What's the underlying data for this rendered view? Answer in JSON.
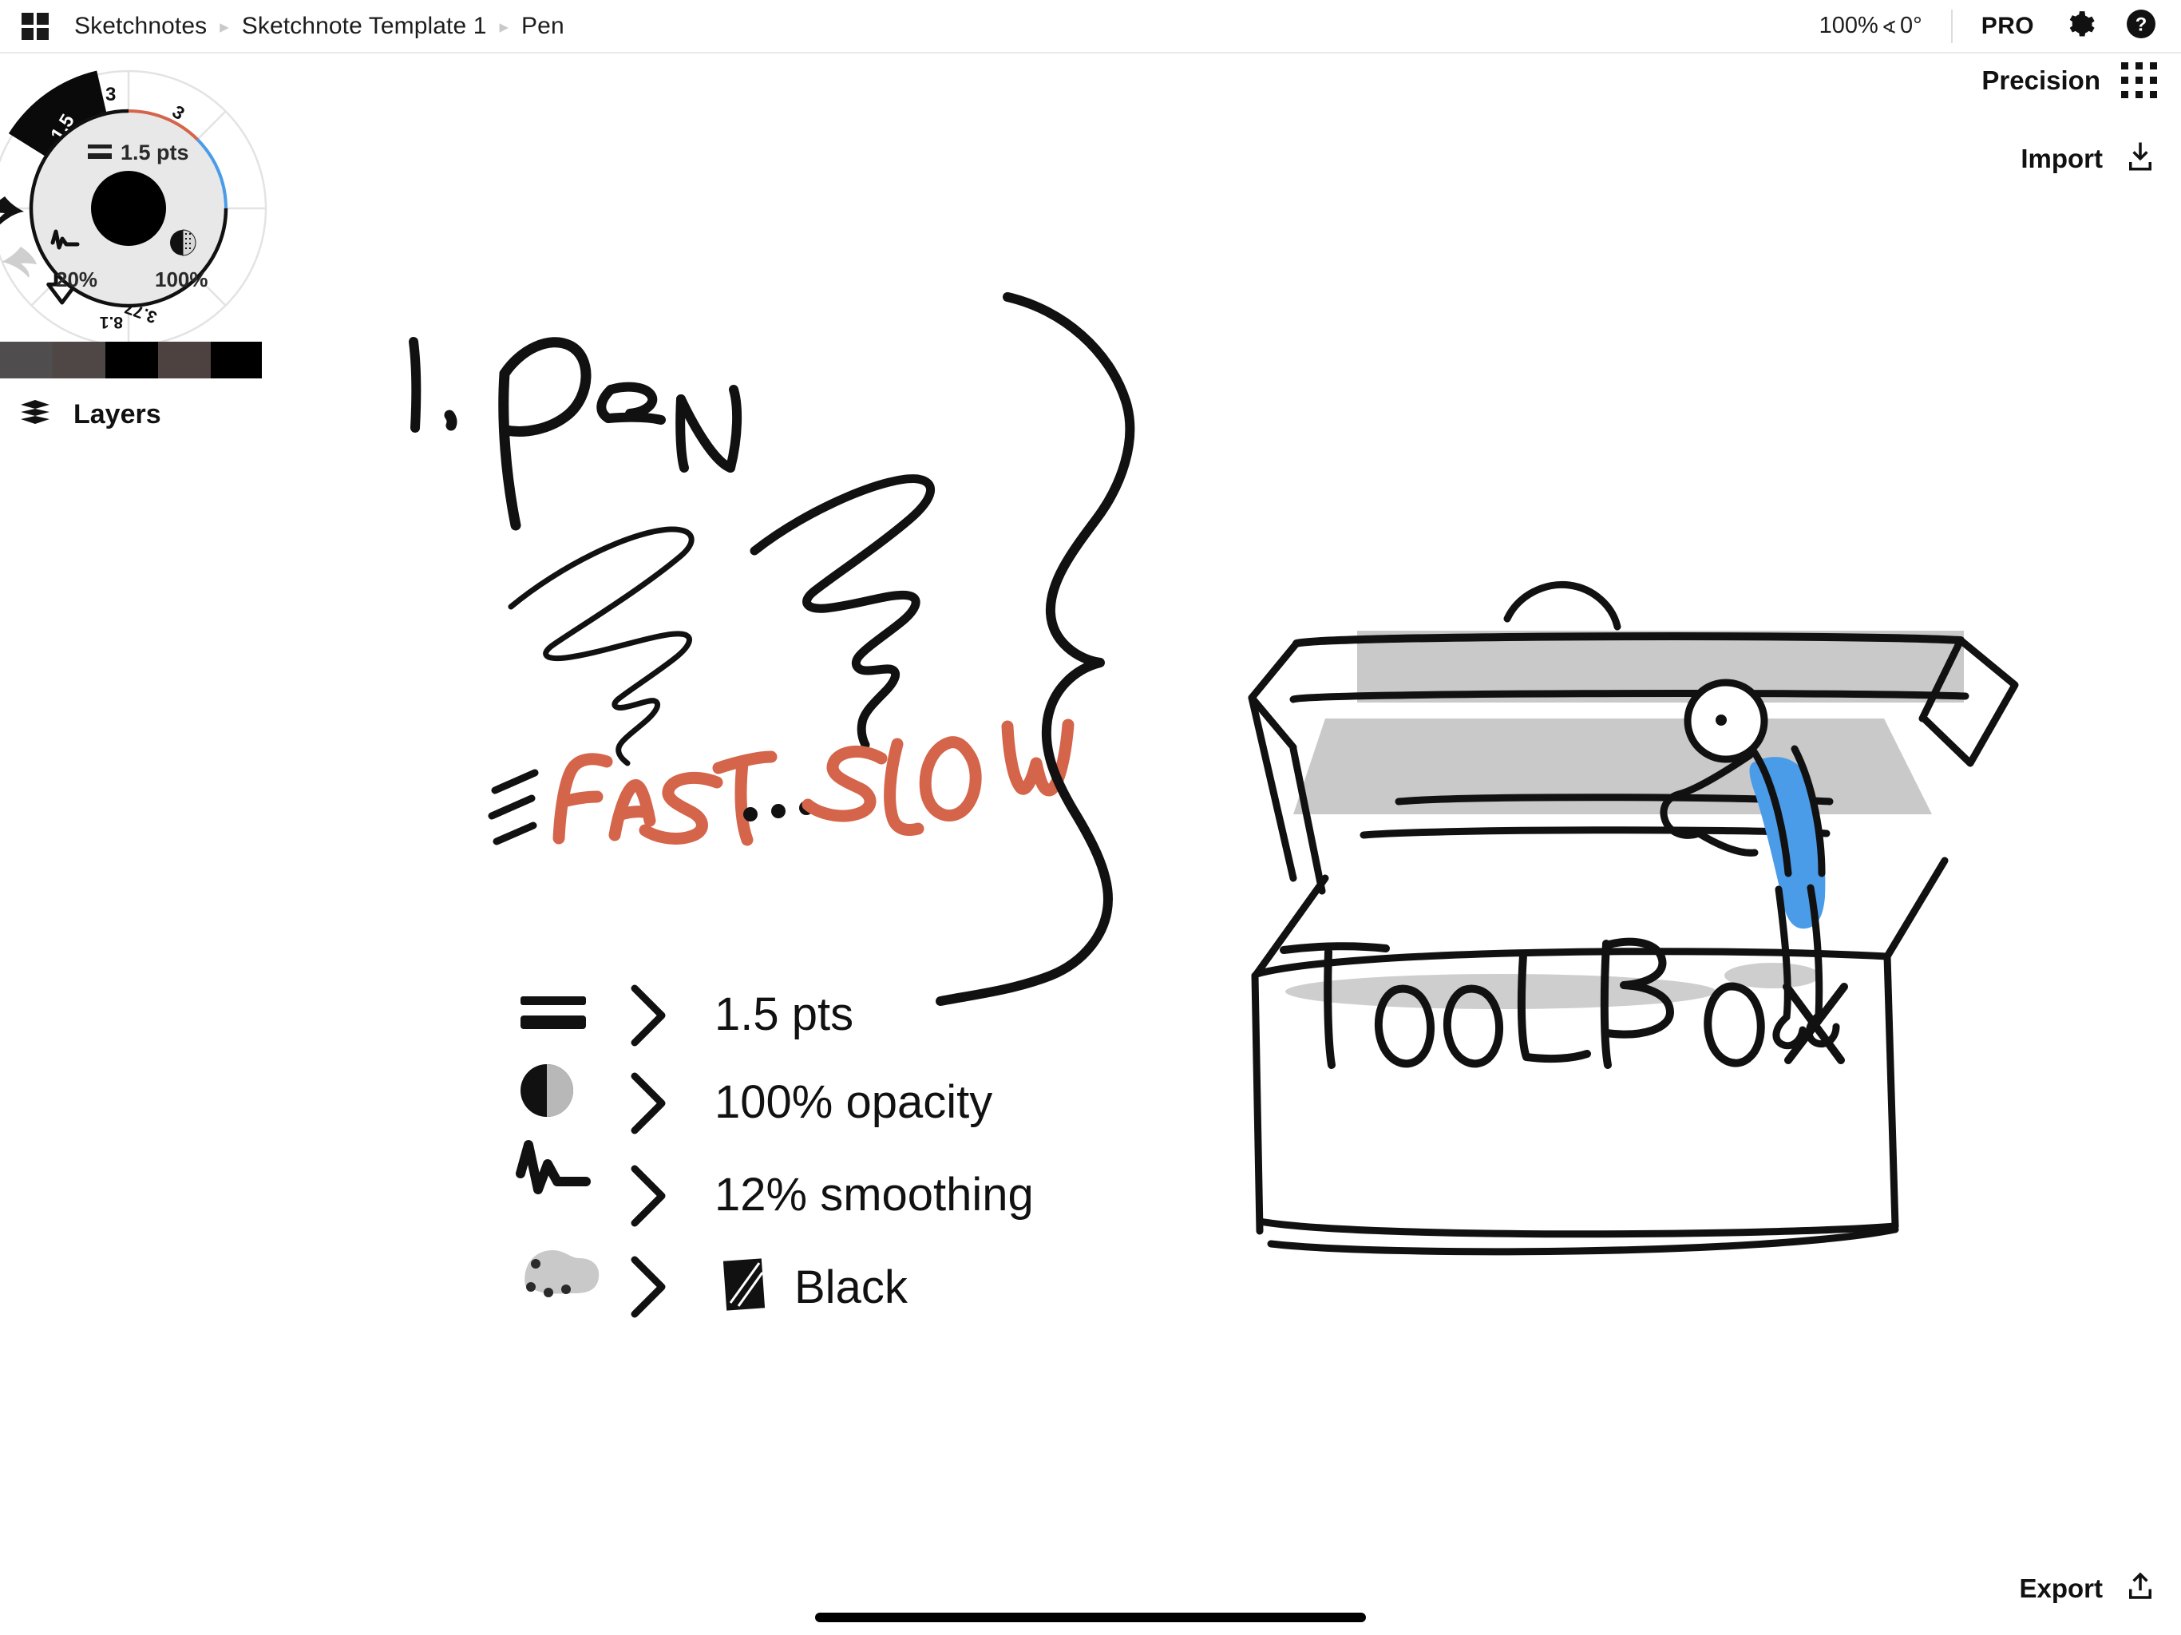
{
  "app": {
    "name": "Sketchnotes",
    "background_color": "#ffffff",
    "ink_black": "#111111",
    "ink_red": "#d4654b",
    "ink_blue": "#4a9be8",
    "ink_gray": "#c9c9c9"
  },
  "topbar": {
    "app_grid_icon": "grid-apps-icon",
    "breadcrumb": [
      {
        "label": "Sketchnotes"
      },
      {
        "label": "Sketchnote Template 1"
      },
      {
        "label": "Pen"
      }
    ],
    "breadcrumb_separator": "▸",
    "zoom_level": "100%",
    "rotation_glyph": "∢",
    "rotation": "0°",
    "pro_badge": "PRO",
    "settings_icon": "gear-icon",
    "help_icon": "help-circle-icon"
  },
  "panels": {
    "precision_label": "Precision",
    "precision_icon": "dot-grid-icon",
    "import_label": "Import",
    "import_icon": "download-icon",
    "export_label": "Export",
    "export_icon": "upload-icon"
  },
  "radial_menu": {
    "center_color": "#000000",
    "ring_background": "#e8e8e8",
    "size_readout": "1.5 pts",
    "size_readout_icon": "line-weight-icon",
    "smoothing_value": "20%",
    "smoothing_icon": "smoothing-wave-icon",
    "opacity_value": "100%",
    "opacity_icon": "opacity-half-circle-icon",
    "sectors": [
      {
        "name": "pen-1-5",
        "label": "1.5",
        "color": "#ffffff",
        "selected": true,
        "icon": "stroke-squiggle-icon"
      },
      {
        "name": "pen-3-black",
        "label": "3",
        "color": "#111111",
        "selected": false,
        "icon": "stroke-squiggle-icon"
      },
      {
        "name": "pen-3-red",
        "label": "3",
        "color": "#d4654b",
        "selected": false,
        "icon": "stroke-squiggle-icon"
      },
      {
        "name": "swatch-blue",
        "label": "",
        "color": "#4a9be8",
        "selected": false,
        "icon": "brush-blob-icon"
      },
      {
        "name": "swatch-gray",
        "label": "",
        "color": "#595959",
        "selected": false,
        "icon": "brush-blob-icon"
      },
      {
        "name": "marker-3-77",
        "label": "3.77",
        "color": "#111111",
        "selected": false,
        "icon": "marker-chisel-icon"
      },
      {
        "name": "curve-8-1",
        "label": "8.1",
        "color": "#111111",
        "selected": false,
        "icon": "curve-wave-icon"
      },
      {
        "name": "select-arrow",
        "label": "",
        "color": "#111111",
        "selected": false,
        "icon": "arrow-outline-icon"
      }
    ],
    "undo_icon": "undo-arrow-icon",
    "redo_icon": "redo-arrow-icon"
  },
  "swatch_bar": {
    "swatches": [
      {
        "name": "swatch-1",
        "color": "#4f4d4d",
        "width": 66
      },
      {
        "name": "swatch-2",
        "color": "#4e4745",
        "width": 66
      },
      {
        "name": "swatch-3",
        "color": "#000000",
        "width": 66
      },
      {
        "name": "swatch-4",
        "color": "#4d4240",
        "width": 66
      },
      {
        "name": "swatch-5",
        "color": "#000000",
        "width": 64
      }
    ]
  },
  "layers": {
    "label": "Layers",
    "icon": "layers-stack-icon"
  },
  "canvas": {
    "title": "1. PEN",
    "speed_annotation": {
      "tick_marks": "≡",
      "fast": "FAST",
      "ellipsis": "...",
      "slow": "SLOW",
      "color": "#d4654b"
    },
    "stroke_samples": [
      {
        "name": "fast-stroke-sample",
        "style": "thin-zigzag"
      },
      {
        "name": "slow-stroke-sample",
        "style": "thick-zigzag"
      }
    ],
    "settings_list": [
      {
        "icon": "line-weight-icon",
        "arrow": ">",
        "value": "1.5 pts"
      },
      {
        "icon": "opacity-half-circle-icon",
        "arrow": ">",
        "value": "100% opacity"
      },
      {
        "icon": "smoothing-wave-icon",
        "arrow": ">",
        "value": "12% smoothing"
      },
      {
        "icon": "color-palette-icon",
        "arrow": ">",
        "value": "Black",
        "swatch_icon": "black-swatch-icon"
      }
    ],
    "brace": "curly-brace-right",
    "illustration": {
      "name": "toolbox-illustration",
      "box_label": "TOOLBOX",
      "shading_color": "#c9c9c9",
      "figure_shirt_color": "#4a9be8"
    }
  },
  "home_indicator": "home-indicator-bar"
}
